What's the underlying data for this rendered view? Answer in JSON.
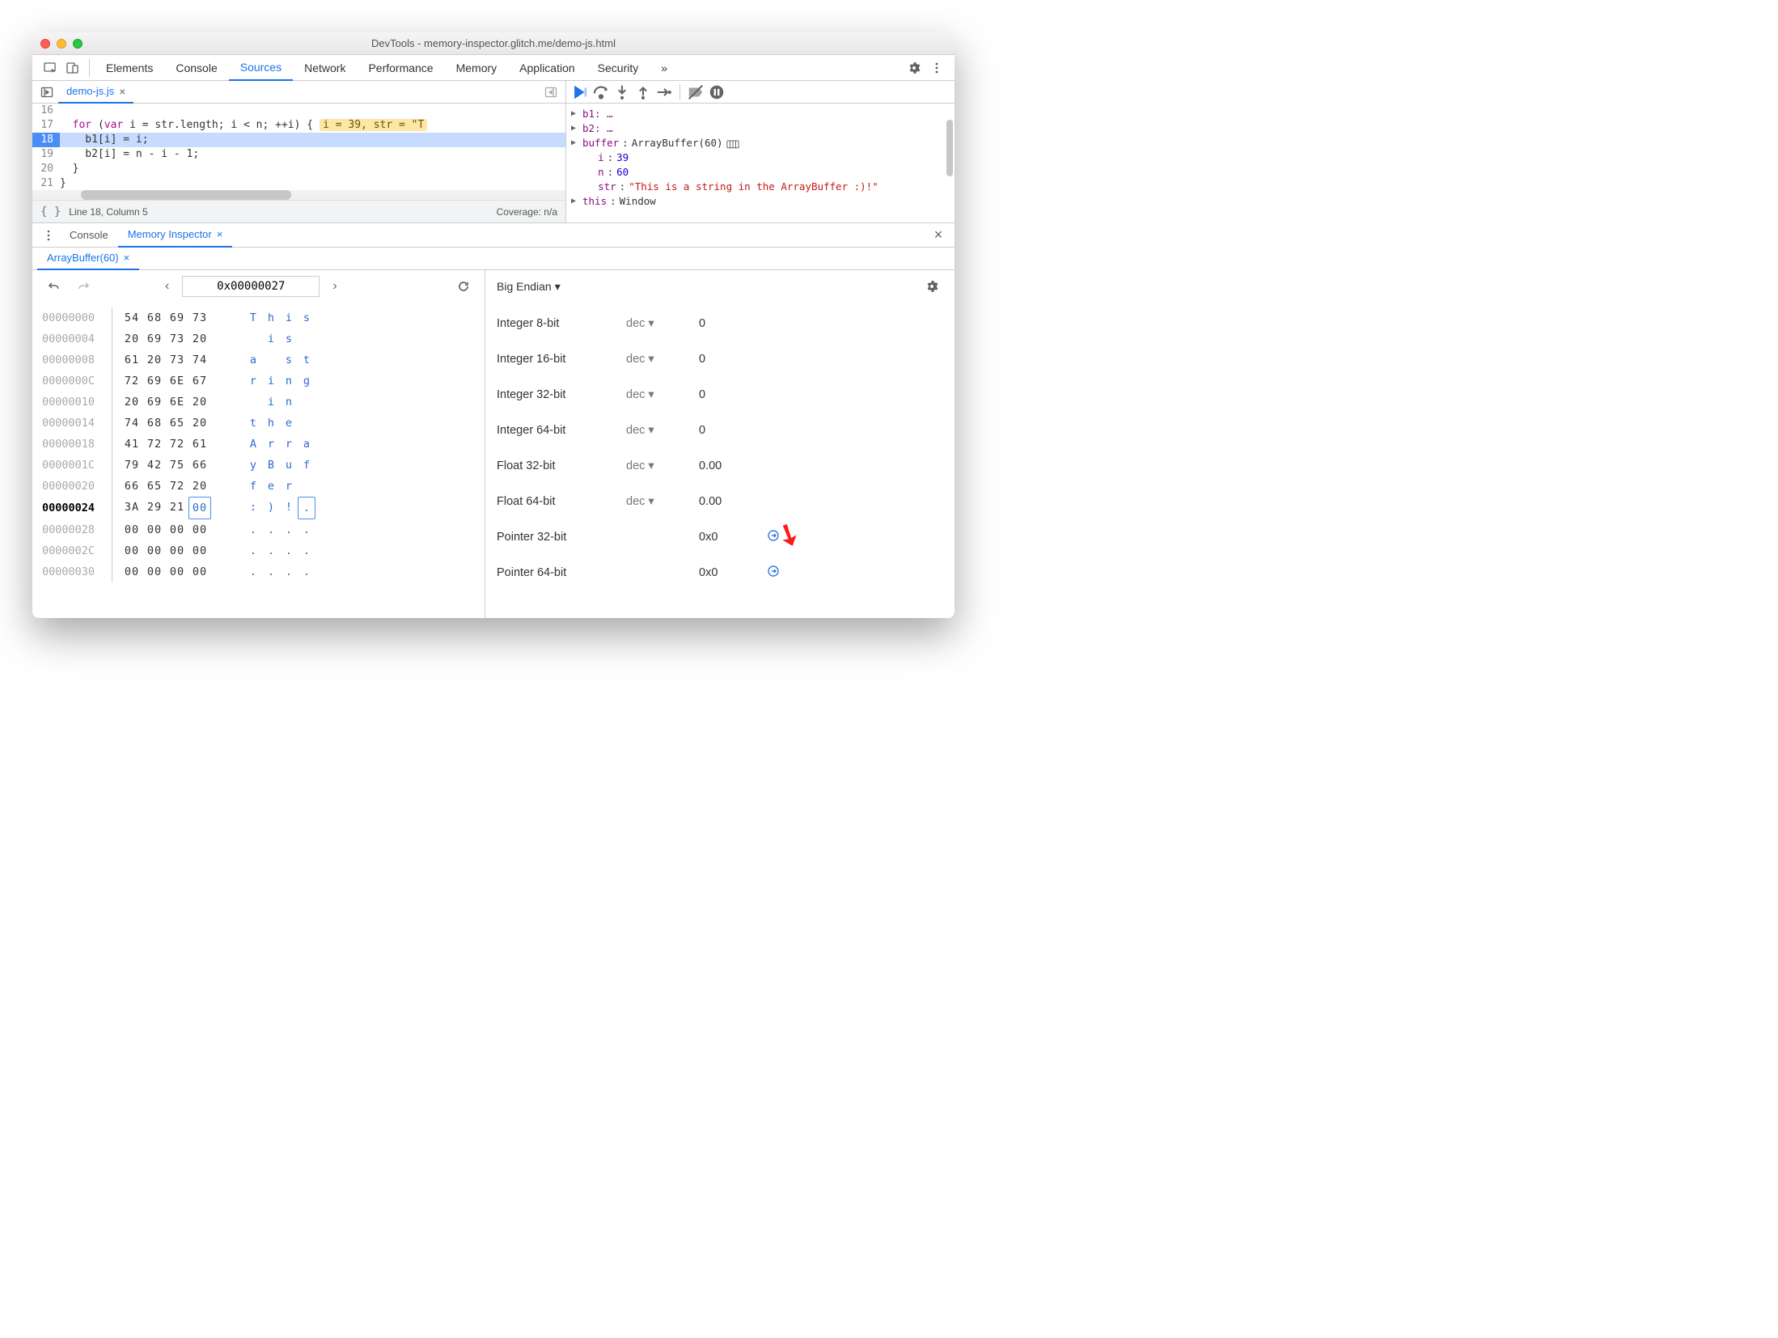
{
  "window": {
    "title": "DevTools - memory-inspector.glitch.me/demo-js.html"
  },
  "mainTabs": {
    "elements": "Elements",
    "console": "Console",
    "sources": "Sources",
    "network": "Network",
    "performance": "Performance",
    "memory": "Memory",
    "application": "Application",
    "security": "Security",
    "more": "»"
  },
  "sources": {
    "fileTab": "demo-js.js",
    "lines": {
      "16": "",
      "17_pre": "  ",
      "17_for": "for",
      "17_paren": " (",
      "17_var": "var",
      "17_rest": " i = str.length; i < n; ++i) {",
      "17_hint": "i = 39, str = \"T",
      "18": "    b1[i] = i;",
      "19": "    b2[i] = n - i - 1;",
      "20": "  }",
      "21": "}",
      "22": ""
    },
    "status_left": "Line 18, Column 5",
    "status_right": "Coverage: n/a"
  },
  "scope": {
    "b1": "b1: …",
    "b2": "b2: …",
    "buffer_label": "buffer",
    "buffer_val": "ArrayBuffer(60)",
    "i_label": "i",
    "i_val": "39",
    "n_label": "n",
    "n_val": "60",
    "str_label": "str",
    "str_val": "\"This is a string in the ArrayBuffer :)!\"",
    "this_label": "this",
    "this_val": "Window"
  },
  "drawer": {
    "tab_console": "Console",
    "tab_mi": "Memory Inspector",
    "file_tab": "ArrayBuffer(60)"
  },
  "memory": {
    "address": "0x00000027",
    "rows": [
      {
        "off": "00000000",
        "b": [
          "54",
          "68",
          "69",
          "73"
        ],
        "a": [
          "T",
          "h",
          "i",
          "s"
        ]
      },
      {
        "off": "00000004",
        "b": [
          "20",
          "69",
          "73",
          "20"
        ],
        "a": [
          " ",
          "i",
          "s",
          " "
        ]
      },
      {
        "off": "00000008",
        "b": [
          "61",
          "20",
          "73",
          "74"
        ],
        "a": [
          "a",
          " ",
          "s",
          "t"
        ]
      },
      {
        "off": "0000000C",
        "b": [
          "72",
          "69",
          "6E",
          "67"
        ],
        "a": [
          "r",
          "i",
          "n",
          "g"
        ]
      },
      {
        "off": "00000010",
        "b": [
          "20",
          "69",
          "6E",
          "20"
        ],
        "a": [
          " ",
          "i",
          "n",
          " "
        ]
      },
      {
        "off": "00000014",
        "b": [
          "74",
          "68",
          "65",
          "20"
        ],
        "a": [
          "t",
          "h",
          "e",
          " "
        ]
      },
      {
        "off": "00000018",
        "b": [
          "41",
          "72",
          "72",
          "61"
        ],
        "a": [
          "A",
          "r",
          "r",
          "a"
        ]
      },
      {
        "off": "0000001C",
        "b": [
          "79",
          "42",
          "75",
          "66"
        ],
        "a": [
          "y",
          "B",
          "u",
          "f"
        ]
      },
      {
        "off": "00000020",
        "b": [
          "66",
          "65",
          "72",
          "20"
        ],
        "a": [
          "f",
          "e",
          "r",
          " "
        ]
      },
      {
        "off": "00000024",
        "b": [
          "3A",
          "29",
          "21",
          "00"
        ],
        "a": [
          ":",
          ")",
          "!",
          "."
        ],
        "cur": true,
        "selIdx": 3
      },
      {
        "off": "00000028",
        "b": [
          "00",
          "00",
          "00",
          "00"
        ],
        "a": [
          ".",
          ".",
          ".",
          "."
        ]
      },
      {
        "off": "0000002C",
        "b": [
          "00",
          "00",
          "00",
          "00"
        ],
        "a": [
          ".",
          ".",
          ".",
          "."
        ]
      },
      {
        "off": "00000030",
        "b": [
          "00",
          "00",
          "00",
          "00"
        ],
        "a": [
          ".",
          ".",
          ".",
          "."
        ]
      }
    ]
  },
  "values": {
    "endian": "Big Endian",
    "fmt_dec": "dec",
    "rows": [
      {
        "name": "Integer 8-bit",
        "fmt": true,
        "val": "0"
      },
      {
        "name": "Integer 16-bit",
        "fmt": true,
        "val": "0"
      },
      {
        "name": "Integer 32-bit",
        "fmt": true,
        "val": "0"
      },
      {
        "name": "Integer 64-bit",
        "fmt": true,
        "val": "0"
      },
      {
        "name": "Float 32-bit",
        "fmt": true,
        "val": "0.00"
      },
      {
        "name": "Float 64-bit",
        "fmt": true,
        "val": "0.00"
      },
      {
        "name": "Pointer 32-bit",
        "fmt": false,
        "val": "0x0",
        "jump": true
      },
      {
        "name": "Pointer 64-bit",
        "fmt": false,
        "val": "0x0",
        "jump": true
      }
    ]
  }
}
